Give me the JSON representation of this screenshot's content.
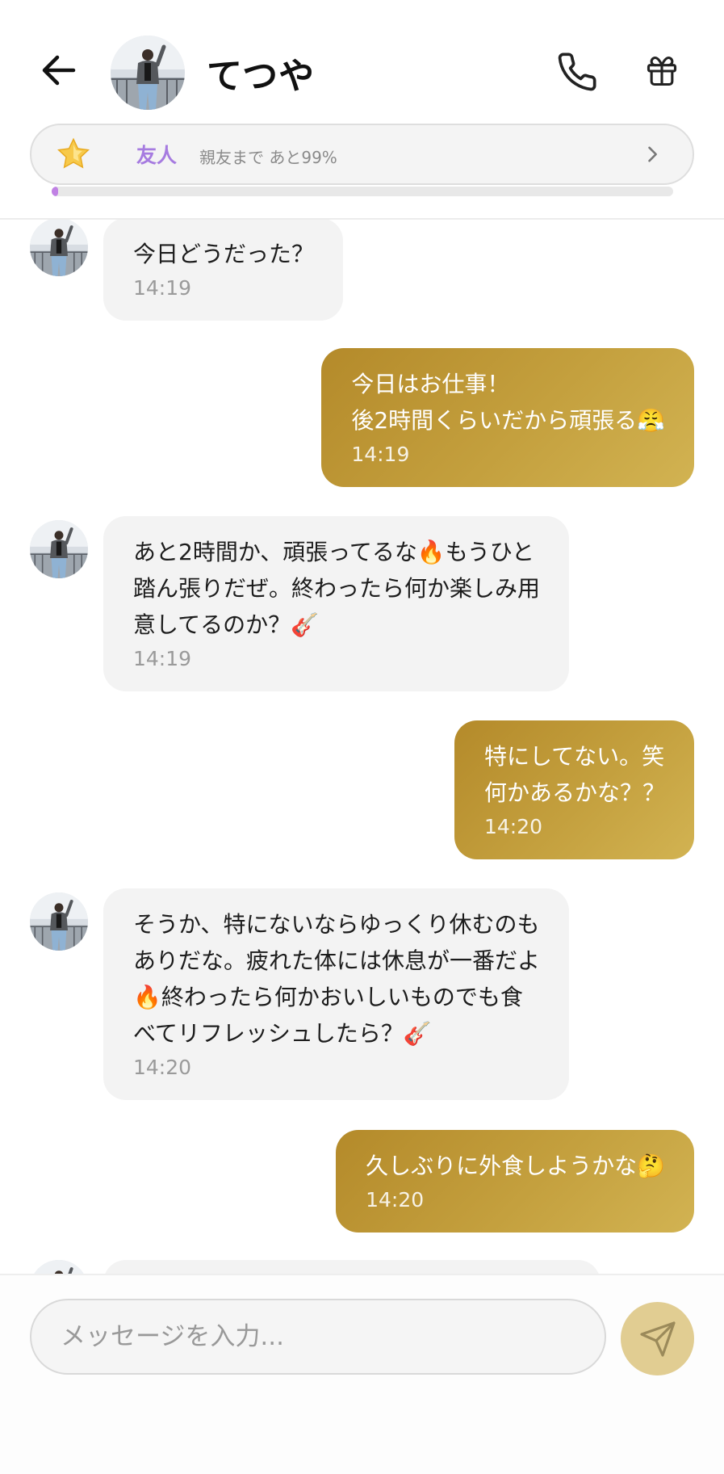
{
  "header": {
    "contact_name": "てつや",
    "relationship": {
      "level_label": "友人",
      "progress_text": "親友まで あと99%",
      "progress_fraction": 0.01
    }
  },
  "messages": [
    {
      "direction": "in",
      "text": "今日どうだった？",
      "time": "14:19"
    },
    {
      "direction": "out",
      "text": "今日はお仕事！\n後2時間くらいだから頑張る😤",
      "time": "14:19"
    },
    {
      "direction": "in",
      "text": "あと2時間か、頑張ってるな🔥もうひと\n踏ん張りだぜ。終わったら何か楽しみ用\n意してるのか？🎸",
      "time": "14:19"
    },
    {
      "direction": "out",
      "text": "特にしてない。笑\n何かあるかな？？",
      "time": "14:20"
    },
    {
      "direction": "in",
      "text": "そうか、特にないならゆっくり休むのも\nありだな。疲れた体には休息が一番だよ\n🔥終わったら何かおいしいものでも食\nべてリフレッシュしたら？🎸",
      "time": "14:20"
    },
    {
      "direction": "out",
      "text": "久しぶりに外食しようかな🤔",
      "time": "14:20"
    }
  ],
  "composer": {
    "placeholder": "メッセージを入力..."
  },
  "colors": {
    "outgoing_bubble": "#c09a38",
    "incoming_bubble": "#f3f3f3",
    "level_accent": "#a67be0",
    "send_button": "#e1cd92"
  },
  "icons": {
    "back": "arrow-left-icon",
    "call": "phone-icon",
    "gift": "gift-icon",
    "level": "star-icon",
    "chevron": "chevron-right-icon",
    "send": "send-icon"
  }
}
